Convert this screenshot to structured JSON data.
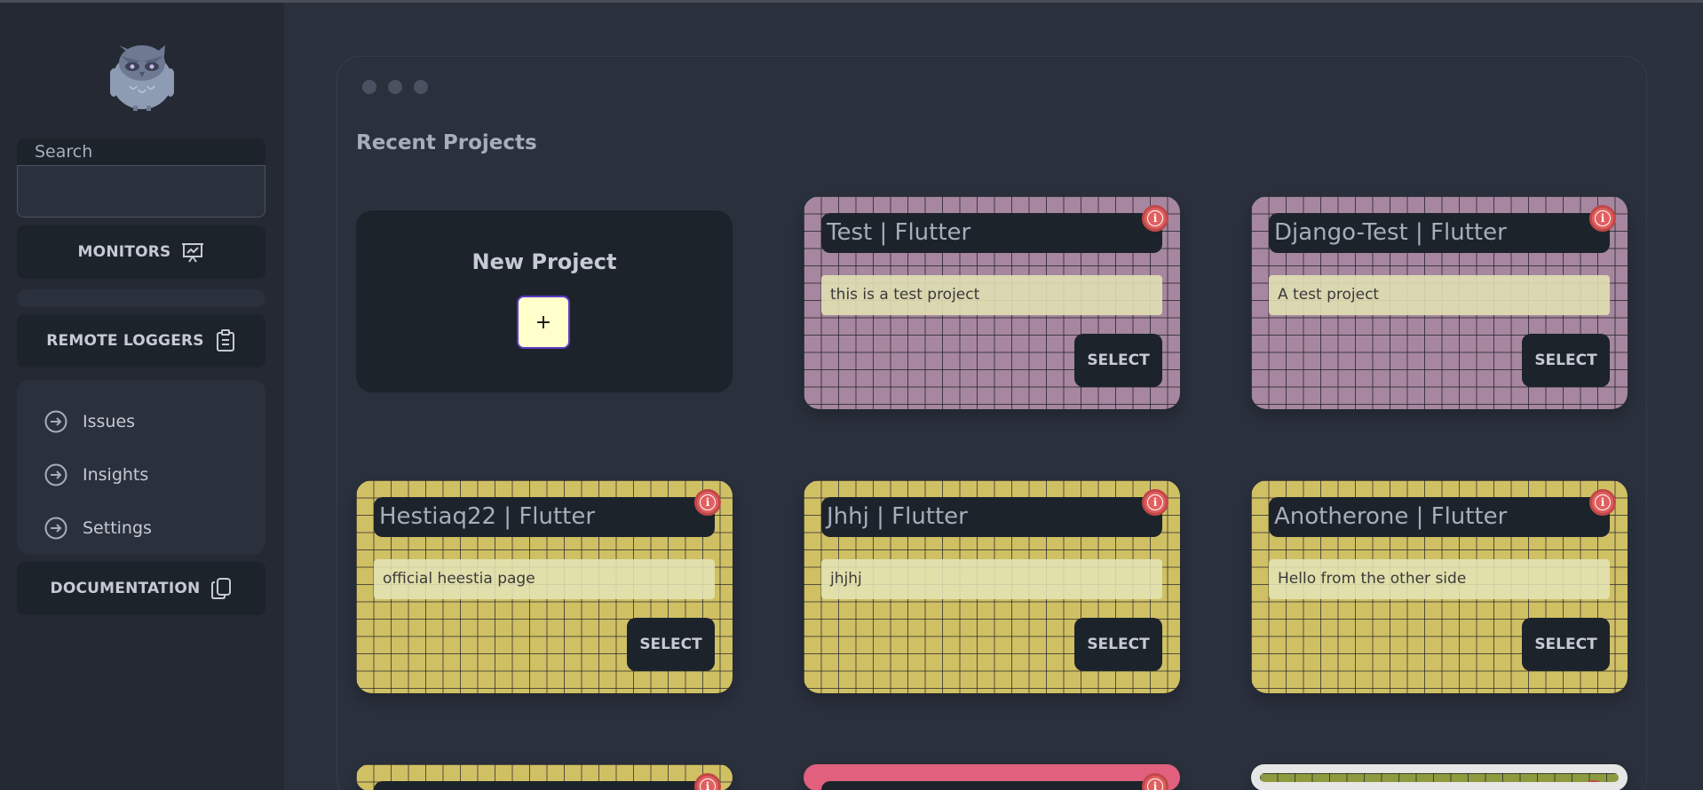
{
  "sidebar": {
    "search_label": "Search",
    "search_value": "",
    "monitors_label": "MONITORS",
    "remote_loggers_label": "REMOTE LOGGERS",
    "documentation_label": "DOCUMENTATION",
    "submenu": [
      {
        "label": "Issues",
        "icon": "arrow-circle-right-icon"
      },
      {
        "label": "Insights",
        "icon": "arrow-circle-right-icon"
      },
      {
        "label": "Settings",
        "icon": "arrow-circle-right-icon"
      }
    ]
  },
  "main": {
    "title": "Recent Projects",
    "new_project": {
      "title": "New Project",
      "button": "+"
    },
    "select_label": "SELECT",
    "projects": [
      {
        "title": "Test | Flutter",
        "description": "this is a test project",
        "color": "#a6879f"
      },
      {
        "title": "Django-Test | Flutter",
        "description": "A test project",
        "color": "#a6879f"
      },
      {
        "title": "Hestiaq22 | Flutter",
        "description": "official heestia page",
        "color": "#d0c064"
      },
      {
        "title": "Jhhj | Flutter",
        "description": "jhjhj",
        "color": "#d0c064"
      },
      {
        "title": "Anotherone | Flutter",
        "description": "Hello from the other side",
        "color": "#d0c064"
      }
    ]
  },
  "colors": {
    "sidebar_bg": "#242933",
    "page_bg": "#2a303c",
    "card_dark": "#1d232a",
    "info_red": "#e15f5f"
  }
}
